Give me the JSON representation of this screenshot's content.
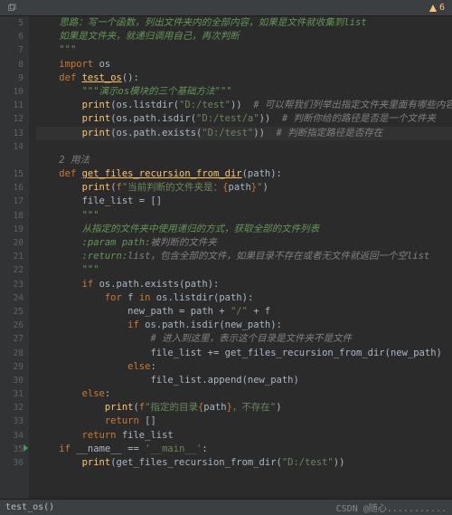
{
  "top": {
    "title": "",
    "warning_count": "6"
  },
  "gutter": {
    "start": 5,
    "end": 36,
    "run_marker_line": 35
  },
  "code": {
    "highlighted_line": 13,
    "lines": [
      {
        "n": 5,
        "seg": [
          [
            "",
            "    "
          ],
          [
            "doc",
            "思路：写一个函数，列出文件夹内的全部内容，如果是文件就收集到list"
          ]
        ]
      },
      {
        "n": 6,
        "seg": [
          [
            "",
            "    "
          ],
          [
            "doc",
            "如果是文件夹，就递归调用自己，再次判断"
          ]
        ]
      },
      {
        "n": 7,
        "seg": [
          [
            "",
            "    "
          ],
          [
            "doc",
            "\"\"\""
          ]
        ]
      },
      {
        "n": 8,
        "seg": [
          [
            "",
            "    "
          ],
          [
            "kw",
            "import"
          ],
          [
            "",
            " "
          ],
          [
            "id",
            "os"
          ]
        ]
      },
      {
        "n": 9,
        "seg": [
          [
            "",
            "    "
          ],
          [
            "kw",
            "def"
          ],
          [
            "",
            " "
          ],
          [
            "fndef",
            "test_os"
          ],
          [
            "id",
            "():"
          ]
        ]
      },
      {
        "n": 10,
        "seg": [
          [
            "",
            "        "
          ],
          [
            "doc",
            "\"\"\"演示os模块的三个基础方法\"\"\""
          ]
        ]
      },
      {
        "n": 11,
        "seg": [
          [
            "",
            "        "
          ],
          [
            "fn",
            "print"
          ],
          [
            "id",
            "(os.listdir("
          ],
          [
            "str",
            "\"D:/test\""
          ],
          [
            "id",
            "))  "
          ],
          [
            "cmt",
            "# 可以帮我们列举出指定文件夹里面有哪些内容"
          ]
        ]
      },
      {
        "n": 12,
        "seg": [
          [
            "",
            "        "
          ],
          [
            "fn",
            "print"
          ],
          [
            "id",
            "(os.path.isdir("
          ],
          [
            "str",
            "\"D:/test/a\""
          ],
          [
            "id",
            "))  "
          ],
          [
            "cmt",
            "# 判断你给的路径是否是一个文件夹"
          ]
        ]
      },
      {
        "n": 13,
        "seg": [
          [
            "",
            "        "
          ],
          [
            "fn",
            "print"
          ],
          [
            "id",
            "(os.path.exists("
          ],
          [
            "str",
            "\"D:/test\""
          ],
          [
            "id",
            "))  "
          ],
          [
            "cmt",
            "# 判断指定路径是否存在"
          ]
        ]
      },
      {
        "n": 14,
        "seg": [
          [
            "",
            ""
          ]
        ]
      },
      {
        "n": "",
        "seg": [
          [
            "",
            "    "
          ],
          [
            "cmt",
            "2 用法"
          ]
        ]
      },
      {
        "n": 15,
        "seg": [
          [
            "",
            "    "
          ],
          [
            "kw",
            "def"
          ],
          [
            "",
            " "
          ],
          [
            "fndef",
            "get_files_recursion_from_dir"
          ],
          [
            "id",
            "(path):"
          ]
        ]
      },
      {
        "n": 16,
        "seg": [
          [
            "",
            "        "
          ],
          [
            "fn",
            "print"
          ],
          [
            "id",
            "("
          ],
          [
            "kw",
            "f"
          ],
          [
            "str",
            "\"当前判断的文件夹是："
          ],
          [
            "brace",
            "{"
          ],
          [
            "id",
            "path"
          ],
          [
            "brace",
            "}"
          ],
          [
            "str",
            "\""
          ],
          [
            "id",
            ")"
          ]
        ]
      },
      {
        "n": 17,
        "seg": [
          [
            "",
            "        "
          ],
          [
            "id",
            "file_list = []"
          ]
        ]
      },
      {
        "n": 18,
        "seg": [
          [
            "",
            "        "
          ],
          [
            "doc",
            "\"\"\""
          ]
        ]
      },
      {
        "n": 19,
        "seg": [
          [
            "",
            "        "
          ],
          [
            "doc",
            "从指定的文件夹中使用递归的方式，获取全部的文件列表"
          ]
        ]
      },
      {
        "n": 20,
        "seg": [
          [
            "",
            "        "
          ],
          [
            "doc",
            ":param path:"
          ],
          [
            "cmt",
            "被判断的文件夹"
          ]
        ]
      },
      {
        "n": 21,
        "seg": [
          [
            "",
            "        "
          ],
          [
            "doc",
            ":return:"
          ],
          [
            "cmt",
            "list，包含全部的文件，如果目录不存在或者无文件就返回一个空list"
          ]
        ]
      },
      {
        "n": 22,
        "seg": [
          [
            "",
            "        "
          ],
          [
            "doc",
            "\"\"\""
          ]
        ]
      },
      {
        "n": 23,
        "seg": [
          [
            "",
            "        "
          ],
          [
            "kw",
            "if"
          ],
          [
            "",
            " "
          ],
          [
            "id",
            "os.path.exists(path):"
          ]
        ]
      },
      {
        "n": 24,
        "seg": [
          [
            "",
            "            "
          ],
          [
            "kw",
            "for"
          ],
          [
            "",
            " "
          ],
          [
            "id",
            "f "
          ],
          [
            "kw",
            "in"
          ],
          [
            "",
            " "
          ],
          [
            "id",
            "os.listdir(path):"
          ]
        ]
      },
      {
        "n": 25,
        "seg": [
          [
            "",
            "                "
          ],
          [
            "id",
            "new_path = path + "
          ],
          [
            "str",
            "\"/\""
          ],
          [
            "id",
            " + f"
          ]
        ]
      },
      {
        "n": 26,
        "seg": [
          [
            "",
            "                "
          ],
          [
            "kw",
            "if"
          ],
          [
            "",
            " "
          ],
          [
            "id",
            "os.path.isdir(new_path):"
          ]
        ]
      },
      {
        "n": 27,
        "seg": [
          [
            "",
            "                    "
          ],
          [
            "cmt",
            "# 进入到这里，表示这个目录是文件夹不是文件"
          ]
        ]
      },
      {
        "n": 28,
        "seg": [
          [
            "",
            "                    "
          ],
          [
            "id",
            "file_list += get_files_recursion_from_dir(new_path)"
          ]
        ]
      },
      {
        "n": 29,
        "seg": [
          [
            "",
            "                "
          ],
          [
            "kw",
            "else"
          ],
          [
            "id",
            ":"
          ]
        ]
      },
      {
        "n": 30,
        "seg": [
          [
            "",
            "                    "
          ],
          [
            "id",
            "file_list.append(new_path)"
          ]
        ]
      },
      {
        "n": 31,
        "seg": [
          [
            "",
            "        "
          ],
          [
            "kw",
            "else"
          ],
          [
            "id",
            ":"
          ]
        ]
      },
      {
        "n": 32,
        "seg": [
          [
            "",
            "            "
          ],
          [
            "fn",
            "print"
          ],
          [
            "id",
            "("
          ],
          [
            "kw",
            "f"
          ],
          [
            "str",
            "\"指定的目录"
          ],
          [
            "brace",
            "{"
          ],
          [
            "id",
            "path"
          ],
          [
            "brace",
            "}"
          ],
          [
            "str",
            "，不存在\""
          ],
          [
            "id",
            ")"
          ]
        ]
      },
      {
        "n": 33,
        "seg": [
          [
            "",
            "            "
          ],
          [
            "kw",
            "return"
          ],
          [
            "",
            " "
          ],
          [
            "id",
            "[]"
          ]
        ]
      },
      {
        "n": 34,
        "seg": [
          [
            "",
            "        "
          ],
          [
            "kw",
            "return"
          ],
          [
            "",
            " "
          ],
          [
            "id",
            "file_list"
          ]
        ]
      },
      {
        "n": 35,
        "seg": [
          [
            "",
            "    "
          ],
          [
            "kw",
            "if"
          ],
          [
            "",
            " "
          ],
          [
            "id",
            "__name__ == "
          ],
          [
            "str",
            "'__main__'"
          ],
          [
            "id",
            ":"
          ]
        ]
      },
      {
        "n": 36,
        "seg": [
          [
            "",
            "        "
          ],
          [
            "fn",
            "print"
          ],
          [
            "id",
            "(get_files_recursion_from_dir("
          ],
          [
            "str",
            "\"D:/test\""
          ],
          [
            "id",
            "))"
          ]
        ]
      }
    ]
  },
  "status": {
    "breadcrumb": "test_os()",
    "watermark": "CSDN @随心..........."
  }
}
